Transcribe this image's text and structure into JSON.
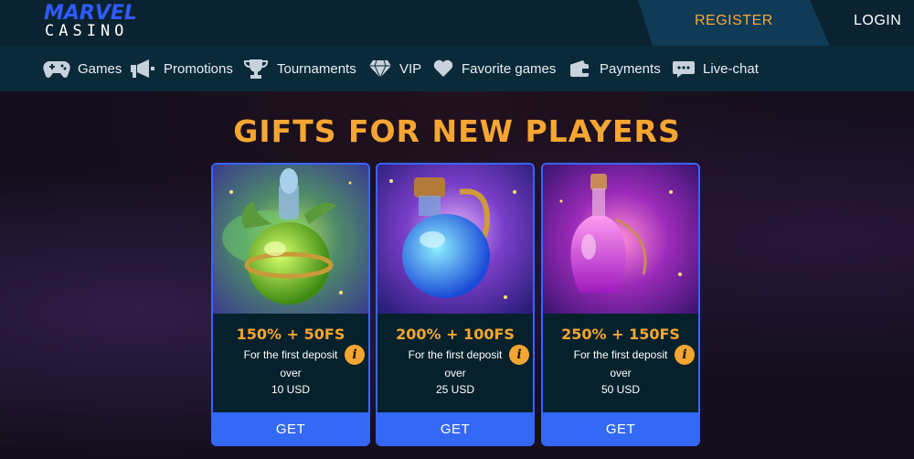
{
  "brand": {
    "line1": "MARVEL",
    "line2": "CASINO"
  },
  "auth": {
    "register_label": "REGISTER",
    "login_label": "LOGIN"
  },
  "nav": {
    "items": [
      {
        "label": "Games",
        "icon": "gamepad-icon"
      },
      {
        "label": "Promotions",
        "icon": "megaphone-icon"
      },
      {
        "label": "Tournaments",
        "icon": "trophy-icon"
      },
      {
        "label": "VIP",
        "icon": "diamond-icon"
      },
      {
        "label": "Favorite games",
        "icon": "heart-icon"
      },
      {
        "label": "Payments",
        "icon": "wallet-icon"
      },
      {
        "label": "Live-chat",
        "icon": "chat-icon"
      }
    ]
  },
  "hero": {
    "title": "GIFTS FOR NEW PLAYERS"
  },
  "offers": [
    {
      "bonus": "150% + 50FS",
      "line1": "For the first deposit",
      "line2": "over",
      "amount": "10 USD",
      "cta": "GET",
      "potion": "green-potion",
      "info": "i"
    },
    {
      "bonus": "200% + 100FS",
      "line1": "For the first deposit",
      "line2": "over",
      "amount": "25 USD",
      "cta": "GET",
      "potion": "blue-potion",
      "info": "i"
    },
    {
      "bonus": "250% + 150FS",
      "line1": "For the first deposit",
      "line2": "over",
      "amount": "50 USD",
      "cta": "GET",
      "potion": "pink-potion",
      "info": "i"
    }
  ],
  "colors": {
    "accent": "#f5a632",
    "button": "#3469f5",
    "header_bg": "#0b2230",
    "nav_bg": "#0a2a3a",
    "logo_blue": "#2f5bff"
  }
}
